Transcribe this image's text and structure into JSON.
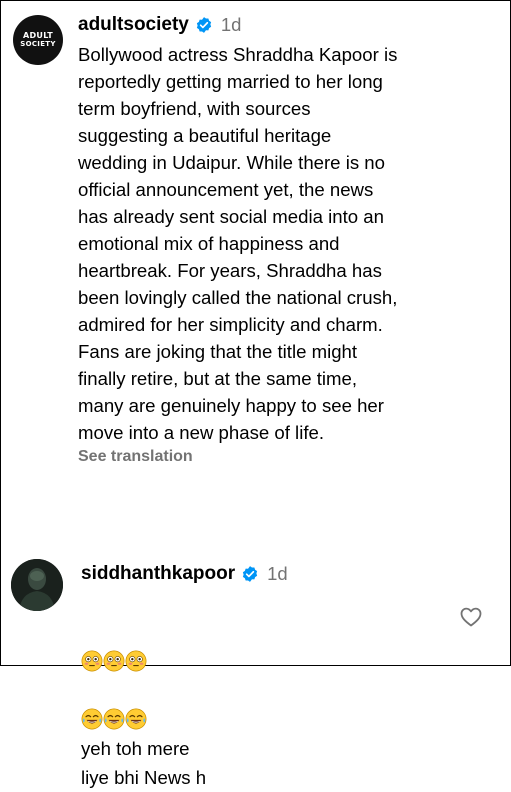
{
  "post": {
    "avatar_text_line1": "ADULT",
    "avatar_text_line2": "SOCIETY",
    "username": "adultsociety",
    "time": "1d",
    "caption": "Bollywood actress Shraddha Kapoor is\nreportedly getting married to her long\nterm boyfriend, with sources\nsuggesting a beautiful heritage\nwedding in Udaipur. While there is no\nofficial announcement yet, the news\nhas already sent social media into an\nemotional mix of happiness and\nheartbreak. For years, Shraddha has\nbeen lovingly called the national crush,\nadmired for her simplicity and charm.\nFans are joking that the title might\nfinally retire, but at the same time,\nmany are genuinely happy to see her\nmove into a new phase of life.",
    "see_translation": "See translation"
  },
  "comment": {
    "username": "siddhanthkapoor",
    "time": "1d",
    "emojis": [
      "flushed-face",
      "flushed-face",
      "flushed-face",
      "tears-of-joy",
      "tears-of-joy",
      "tears-of-joy"
    ],
    "text_line1": "yeh toh mere",
    "text_line2": "liye bhi News h"
  },
  "colors": {
    "verified": "#0095f6",
    "muted": "#737373"
  },
  "icons": {
    "verified": "verified-badge-icon",
    "like": "heart-outline-icon"
  }
}
